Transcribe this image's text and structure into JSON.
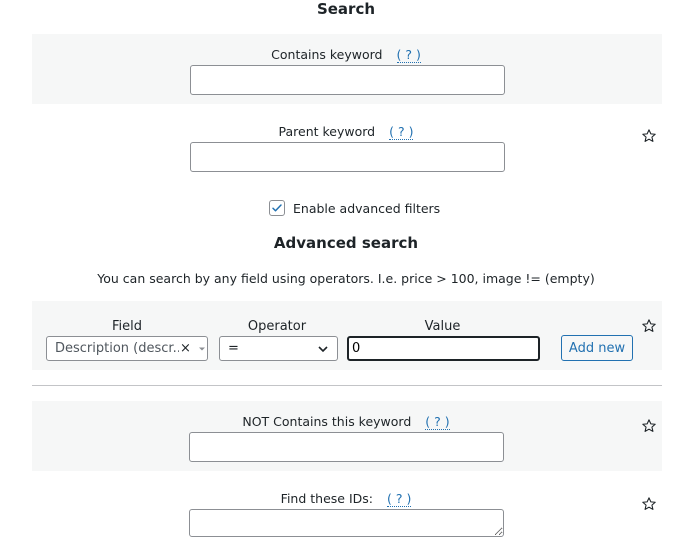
{
  "header": {
    "title": "Search"
  },
  "contains_keyword": {
    "label": "Contains keyword",
    "help": "( ? )",
    "value": ""
  },
  "parent_keyword": {
    "label": "Parent keyword",
    "help": "( ? )",
    "value": ""
  },
  "advanced_toggle": {
    "label": "Enable advanced filters",
    "checked": true
  },
  "advanced": {
    "title": "Advanced search",
    "description": "You can search by any field using operators. I.e. price > 100, image != (empty)",
    "columns": {
      "field": "Field",
      "operator": "Operator",
      "value": "Value"
    },
    "field_select": {
      "selected": "Description (descr..."
    },
    "operator_select": {
      "selected": "="
    },
    "value_input": {
      "value": "0"
    },
    "add_button": "Add new"
  },
  "not_contains": {
    "label": "NOT Contains this keyword",
    "help": "( ? )",
    "value": ""
  },
  "find_ids": {
    "label": "Find these IDs:",
    "help": "( ? )",
    "value": ""
  },
  "colors": {
    "accent": "#2271b1",
    "band": "#f6f7f7",
    "border": "#8c8f94",
    "text": "#1d2327"
  },
  "icons": [
    "star-icon",
    "clear-icon",
    "chevron-down-icon",
    "checkmark-icon"
  ]
}
